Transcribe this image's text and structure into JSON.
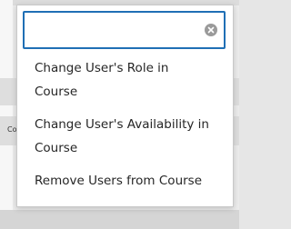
{
  "background": {
    "row_text": "Co"
  },
  "search": {
    "value": "",
    "placeholder": "",
    "clear_icon": "clear-circle-icon"
  },
  "menu": {
    "items": [
      {
        "line1": "Change User's Role in",
        "line2": "Course"
      },
      {
        "line1": "Change User's Availability in",
        "line2": "Course"
      },
      {
        "line1": "Remove Users from Course"
      }
    ]
  },
  "colors": {
    "focus_border": "#1f6fb5",
    "text": "#262626",
    "clear_icon": "#9a9a9a"
  }
}
